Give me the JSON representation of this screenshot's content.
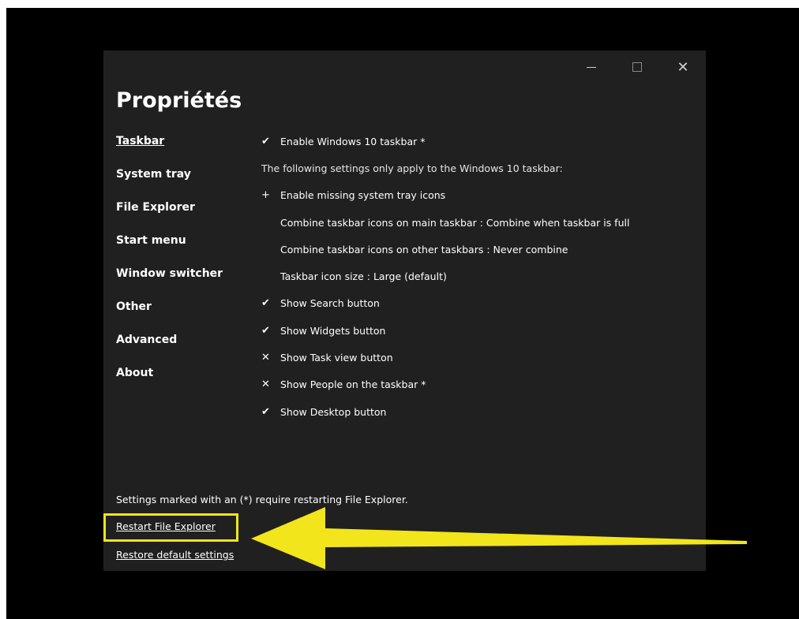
{
  "window": {
    "title": "Propriétés",
    "controls": {
      "minimize": "–",
      "maximize": "□",
      "close": "✕"
    }
  },
  "sidebar": {
    "items": [
      {
        "label": "Taskbar",
        "active": true
      },
      {
        "label": "System tray"
      },
      {
        "label": "File Explorer"
      },
      {
        "label": "Start menu"
      },
      {
        "label": "Window switcher"
      },
      {
        "label": "Other"
      },
      {
        "label": "Advanced"
      },
      {
        "label": "About"
      }
    ]
  },
  "settings": {
    "rows": [
      {
        "mark": "✔",
        "label": "Enable Windows 10 taskbar *"
      },
      {
        "mark": "",
        "label": "The following settings only apply to the Windows 10 taskbar:"
      },
      {
        "mark": "+",
        "label": "Enable missing system tray icons"
      },
      {
        "mark": "",
        "label": "Combine taskbar icons on main taskbar : Combine when taskbar is full"
      },
      {
        "mark": "",
        "label": "Combine taskbar icons on other taskbars : Never combine"
      },
      {
        "mark": "",
        "label": "Taskbar icon size : Large (default)"
      },
      {
        "mark": "✔",
        "label": "Show Search button"
      },
      {
        "mark": "✔",
        "label": "Show Widgets button"
      },
      {
        "mark": "✕",
        "label": "Show Task view button"
      },
      {
        "mark": "✕",
        "label": "Show People on the taskbar *"
      },
      {
        "mark": "✔",
        "label": "Show Desktop button"
      }
    ]
  },
  "footer": {
    "note": "Settings marked with an (*) require restarting File Explorer.",
    "restart_label": "Restart File Explorer",
    "restore_label": "Restore default settings"
  },
  "annotation": {
    "color": "#f2e51c"
  }
}
